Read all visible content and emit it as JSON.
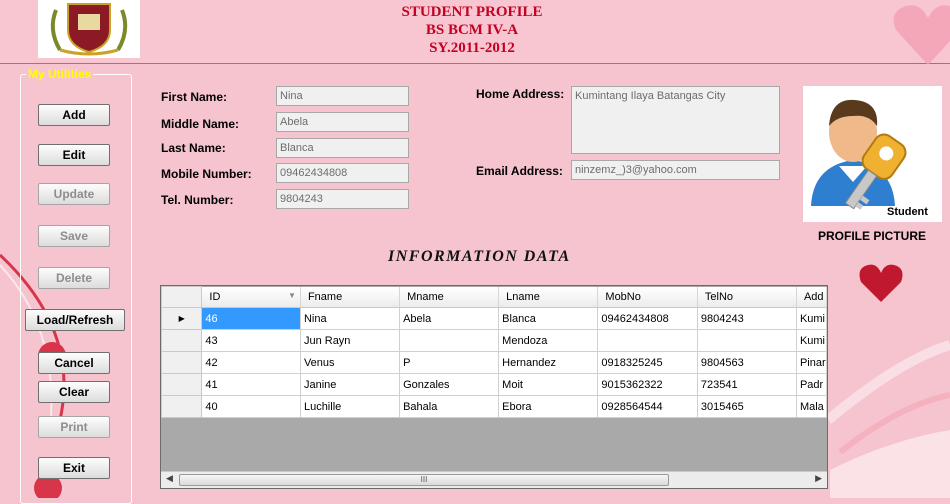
{
  "header": {
    "title_line1": "STUDENT PROFILE",
    "title_line2": "BS BCM IV-A",
    "title_line3": "SY.2011-2012"
  },
  "utilities": {
    "legend": "My Utilities",
    "buttons": {
      "add": "Add",
      "edit": "Edit",
      "update": "Update",
      "save": "Save",
      "delete": "Delete",
      "load_refresh": "Load/Refresh",
      "cancel": "Cancel",
      "clear": "Clear",
      "print": "Print",
      "exit": "Exit"
    }
  },
  "form": {
    "first_name_label": "First Name:",
    "first_name": "Nina",
    "middle_name_label": "Middle Name:",
    "middle_name": "Abela",
    "last_name_label": "Last Name:",
    "last_name": "Blanca",
    "mobile_label": "Mobile Number:",
    "mobile": "09462434808",
    "tel_label": "Tel.  Number:",
    "tel": "9804243",
    "home_address_label": "Home Address:",
    "home_address": "Kumintang Ilaya Batangas City",
    "email_label": "Email Address:",
    "email": "ninzemz_)3@yahoo.com"
  },
  "profile": {
    "badge": "Student",
    "label": "PROFILE PICTURE"
  },
  "info_title": "INFORMATION DATA",
  "grid": {
    "columns": [
      "ID",
      "Fname",
      "Mname",
      "Lname",
      "MobNo",
      "TelNo",
      "Add"
    ],
    "rows": [
      [
        "46",
        "Nina",
        "Abela",
        "Blanca",
        "09462434808",
        "9804243",
        "Kumi"
      ],
      [
        "43",
        "Jun Rayn",
        "",
        "Mendoza",
        "",
        "",
        "Kumi"
      ],
      [
        "42",
        "Venus",
        "P",
        "Hernandez",
        "0918325245",
        "9804563",
        "Pinar"
      ],
      [
        "41",
        "Janine",
        "Gonzales",
        "Moit",
        "9015362322",
        "723541",
        "Padr"
      ],
      [
        "40",
        "Luchille",
        "Bahala",
        "Ebora",
        "0928564544",
        "3015465",
        "Mala"
      ]
    ],
    "current_row_marker": "▶",
    "scroll_thumb": "III"
  },
  "colors": {
    "background": "#f6c4cf",
    "title": "#c40023",
    "legend": "#ffff00",
    "selection": "#3399ff"
  }
}
